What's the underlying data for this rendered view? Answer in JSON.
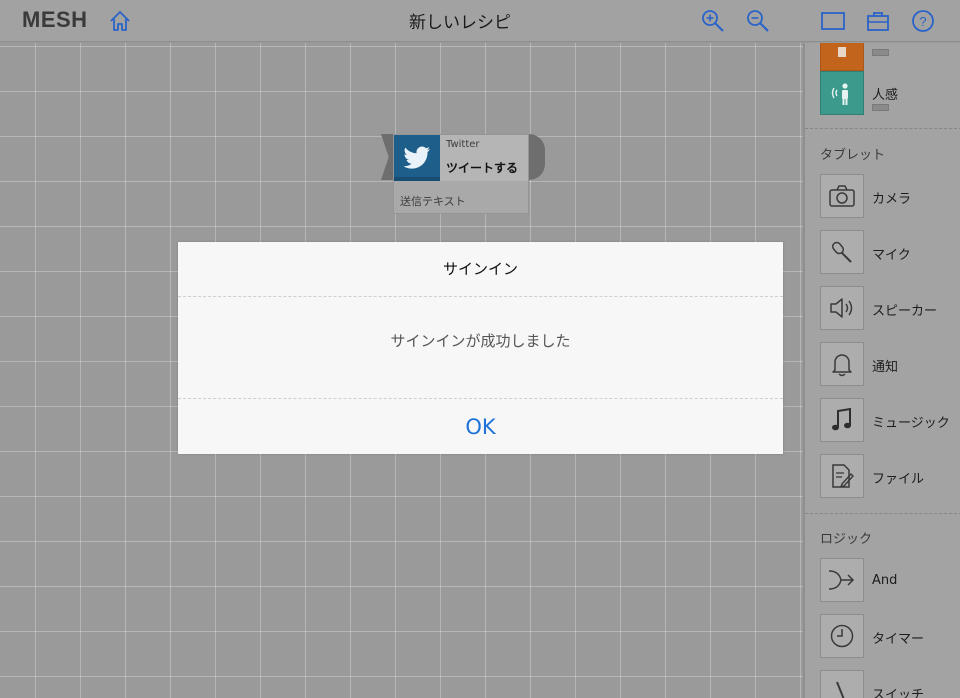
{
  "app": {
    "logo": "MESH",
    "title": "新しいレシピ"
  },
  "toolbar": {
    "home_icon": "home-icon",
    "zoom_in_icon": "zoom-in-icon",
    "zoom_out_icon": "zoom-out-icon",
    "window_icon": "window-icon",
    "toolbox_icon": "toolbox-icon",
    "help_icon": "help-icon",
    "accent": "#2a63c9"
  },
  "canvas": {
    "block": {
      "name": "Twitter",
      "action": "ツイートする",
      "parameter": "送信テキスト",
      "color": "#1d5f8a"
    }
  },
  "panel": {
    "tags": [
      {
        "label": "",
        "icon": "tag-orange-icon",
        "color": "#c2641c"
      },
      {
        "label": "人感",
        "icon": "motion-sensor-icon",
        "color": "#3c9a8c"
      }
    ],
    "sections": [
      {
        "title": "タブレット",
        "items": [
          {
            "label": "カメラ",
            "icon": "camera-icon"
          },
          {
            "label": "マイク",
            "icon": "microphone-icon"
          },
          {
            "label": "スピーカー",
            "icon": "speaker-icon"
          },
          {
            "label": "通知",
            "icon": "bell-icon"
          },
          {
            "label": "ミュージック",
            "icon": "music-note-icon"
          },
          {
            "label": "ファイル",
            "icon": "file-edit-icon"
          }
        ]
      },
      {
        "title": "ロジック",
        "items": [
          {
            "label": "And",
            "icon": "and-merge-icon"
          },
          {
            "label": "タイマー",
            "icon": "timer-icon"
          },
          {
            "label": "スイッチ",
            "icon": "switch-icon"
          }
        ]
      }
    ]
  },
  "dialog": {
    "title": "サインイン",
    "message": "サインインが成功しました",
    "ok_label": "OK",
    "ok_color": "#1f73d6"
  }
}
